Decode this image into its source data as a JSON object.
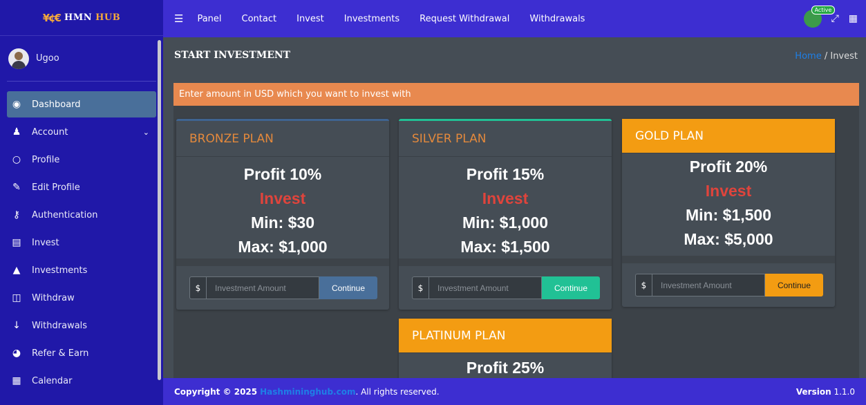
{
  "brand": {
    "logo": "¥¢€",
    "name_part1": "HMN",
    "name_part2": "HUB"
  },
  "user": {
    "name": "Ugoo"
  },
  "sidebar": {
    "items": [
      {
        "label": "Dashboard",
        "icon": "dashboard-icon"
      },
      {
        "label": "Account",
        "icon": "user-icon"
      },
      {
        "label": "Profile",
        "icon": "circle-icon"
      },
      {
        "label": "Edit Profile",
        "icon": "edit-icon"
      },
      {
        "label": "Authentication",
        "icon": "key-icon"
      },
      {
        "label": "Invest",
        "icon": "invest-icon"
      },
      {
        "label": "Investments",
        "icon": "tree-icon"
      },
      {
        "label": "Withdraw",
        "icon": "columns-icon"
      },
      {
        "label": "Withdrawals",
        "icon": "arrow-down-icon"
      },
      {
        "label": "Refer & Earn",
        "icon": "pie-chart-icon"
      },
      {
        "label": "Calendar",
        "icon": "calendar-icon"
      }
    ]
  },
  "topbar": {
    "links": [
      "Panel",
      "Contact",
      "Invest",
      "Investments",
      "Request Withdrawal",
      "Withdrawals"
    ],
    "active_badge": "Active"
  },
  "page": {
    "title": "START INVESTMENT",
    "breadcrumb_home": "Home",
    "breadcrumb_sep": "/",
    "breadcrumb_current": "Invest",
    "alert": "Enter amount in USD which you want to invest with"
  },
  "plans": {
    "bronze": {
      "name": "BRONZE PLAN",
      "profit": "Profit 10%",
      "invest": "Invest",
      "min": "Min:  $30",
      "max": "Max:  $1,000"
    },
    "silver": {
      "name": "SILVER PLAN",
      "profit": "Profit 15%",
      "invest": "Invest",
      "min": "Min:  $1,000",
      "max": "Max:  $1,500"
    },
    "gold": {
      "name": "GOLD PLAN",
      "profit": "Profit 20%",
      "invest": "Invest",
      "min": "Min:  $1,500",
      "max": "Max:  $5,000"
    },
    "platinum": {
      "name": "PLATINUM PLAN",
      "profit": "Profit 25%"
    }
  },
  "form": {
    "prefix": "$",
    "placeholder": "Investment Amount",
    "button": "Continue"
  },
  "footer": {
    "copyright": "Copyright © 2025",
    "site": "Hashmininghub.com",
    "reserved": ". All rights reserved.",
    "version_label": "Version",
    "version": "1.1.0"
  },
  "colors": {
    "sidebar": "#2018a8",
    "topbar": "#3d2ed1",
    "accent_orange": "#f39c12",
    "bronze_button": "#496f9a",
    "silver_button": "#21c195",
    "invest_red": "#e0443c"
  }
}
